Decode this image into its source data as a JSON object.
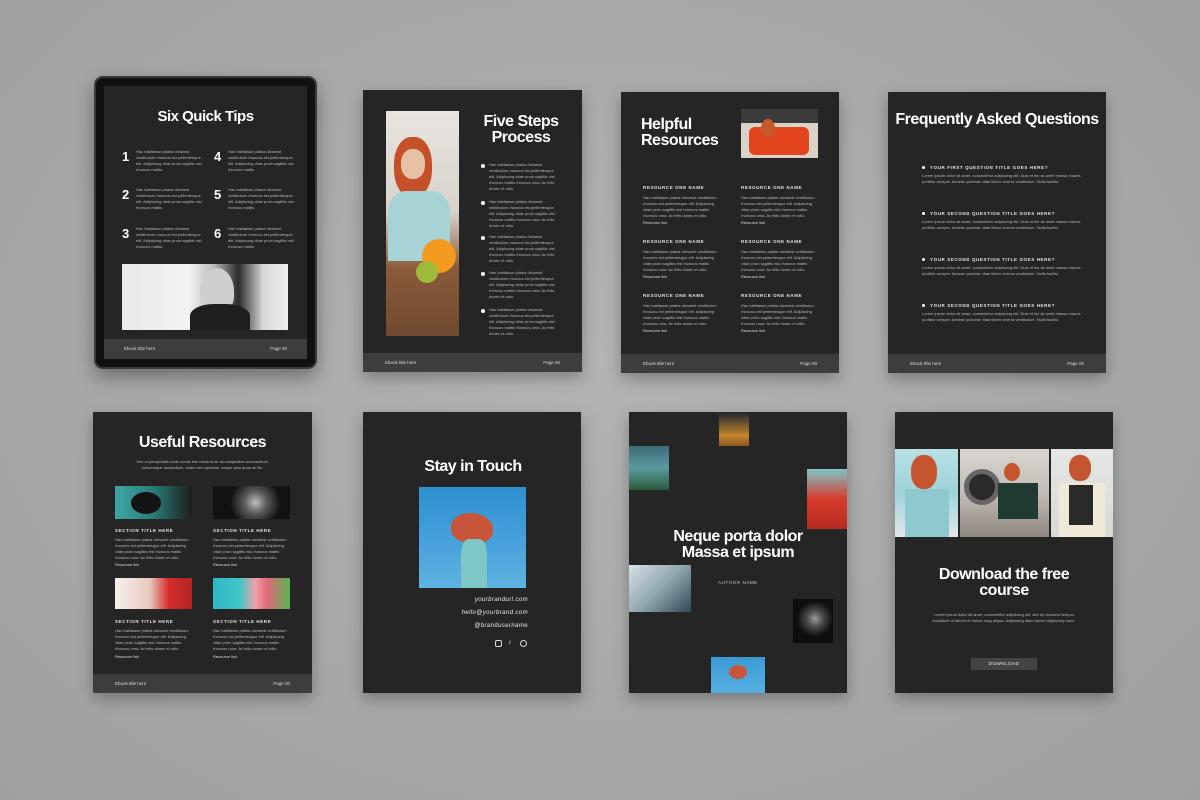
{
  "lorem_short": "Hac habitasse platea dictumst vestibulum rhoncus est pellentesque elit. Adipiscing vitae proin sagittis nisl rhoncus mattis.",
  "lorem_long": "Hac habitasse platea dictumst vestibulum rhoncus est pellentesque elit. Adipiscing vitae proin sagittis nisl rhoncus mattis rhoncus urna. Ac felis donec et odio.",
  "footer": {
    "left": "Ebook title here",
    "right": "Page 00"
  },
  "tips": {
    "title": "Six Quick Tips",
    "numbers": [
      "1",
      "2",
      "3",
      "4",
      "5",
      "6"
    ]
  },
  "steps": {
    "title": "Five Steps Process"
  },
  "helpful": {
    "title": "Helpful Resources",
    "item_name": "RESOURCE ONE NAME",
    "link": "Resource link"
  },
  "faq": {
    "title": "Frequently Asked Questions",
    "questions": [
      "YOUR FIRST QUESTION TITLE GOES HERE?",
      "YOUR SECOND QUESTION TITLE GOES HERE?",
      "YOUR SECOND QUESTION TITLE GOES HERE?",
      "YOUR SECOND QUESTION TITLE GOES HERE?"
    ],
    "answer": "Lorem ipsum dolor sit amet, consectetur adipiscing elit. Duis et leo sit amet massa mauris porttitor semper. Aenean pulvinar vitae libero viverra vestibulum. Nulla facilisi."
  },
  "useful": {
    "title": "Useful Resources",
    "subtitle": "Sed ut perspiciatis unde omnis iste natus error sit voluptatem accusantium doloremque laudantium, totam rem aperiam, eaque ipsa quae ab illo",
    "section": "SECTION TITLE HERE",
    "link": "Resource link"
  },
  "stay": {
    "title": "Stay in Touch",
    "url": "yourbrandurl.com",
    "email": "hello@yourbrand.com",
    "handle": "@brandusername",
    "icons": [
      "instagram-icon",
      "tiktok-icon",
      "pinterest-icon"
    ]
  },
  "neque": {
    "title": "Neque porta dolor Massa et ipsum",
    "author": "AUTHOR NAME"
  },
  "download": {
    "title": "Download the free course",
    "body": "Lorem ipsum dolor sit amet, consectetur adipiscing elit, sed do eiusmod tempor incididunt ut labore et dolore mag aliqua. Adipiscing diam donec adipiscing nunc.",
    "button": "DOWNLOAD"
  }
}
